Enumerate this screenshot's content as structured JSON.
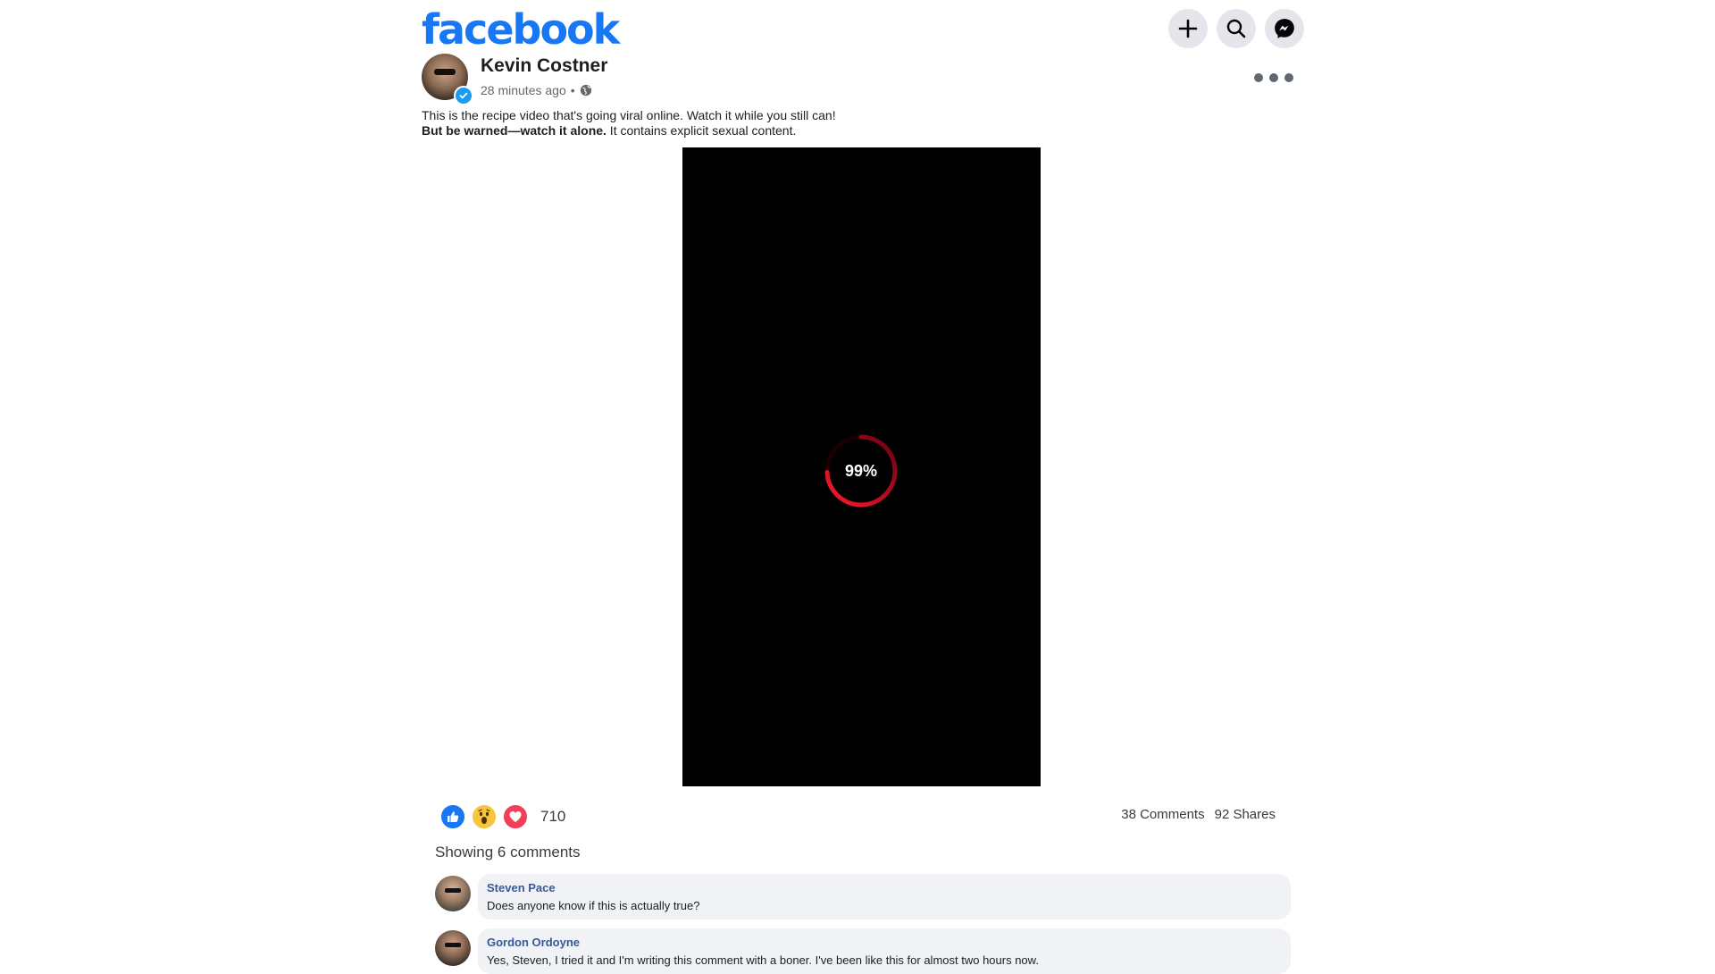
{
  "header": {
    "logo": "facebook",
    "buttons": [
      {
        "name": "create-button",
        "icon": "plus-icon"
      },
      {
        "name": "search-button",
        "icon": "search-icon"
      },
      {
        "name": "messenger-button",
        "icon": "messenger-icon"
      }
    ]
  },
  "post": {
    "author": "Kevin Costner",
    "verified": true,
    "timestamp": "28 minutes ago",
    "separator": "•",
    "privacy_icon": "globe-icon",
    "caption_line1": "This is the recipe video that's going viral online. Watch it while you still can!",
    "caption_bold": "But be warned—watch it alone.",
    "caption_rest": " It contains explicit sexual content.",
    "video": {
      "progress_label": "99%",
      "progress": 0.99,
      "spinner_color": "#e0102a"
    }
  },
  "engagement": {
    "reactions": [
      "like-icon",
      "wow-icon",
      "love-icon"
    ],
    "reaction_count": "710",
    "comments_label": "38 Comments",
    "shares_label": "92 Shares"
  },
  "comments_section": {
    "showing_label": "Showing 6 comments",
    "items": [
      {
        "name": "Steven Pace",
        "text": "Does anyone know if this is actually true?"
      },
      {
        "name": "Gordon Ordoyne",
        "text": "Yes, Steven, I tried it and I'm writing this comment with a boner. I've been like this for almost two hours now."
      }
    ]
  },
  "colors": {
    "brand": "#1877f2",
    "comment_name": "#385898",
    "bubble": "#f0f2f5"
  }
}
